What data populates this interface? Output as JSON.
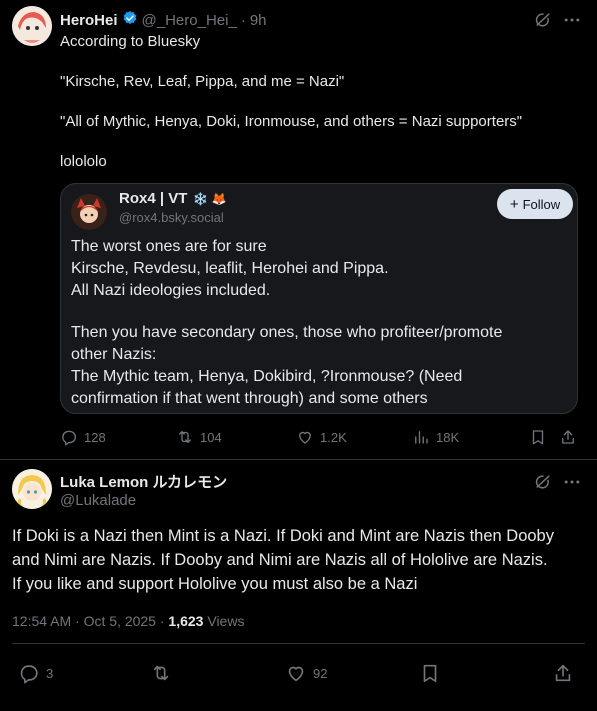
{
  "post1": {
    "author_name": "HeroHei",
    "handle": "@_Hero_Hei_",
    "separator": "·",
    "time": "9h",
    "text_lines": [
      "According to Bluesky",
      "\"Kirsche, Rev, Leaf, Pippa, and me = Nazi\"",
      "\"All of Mythic, Henya, Doki, Ironmouse, and others = Nazi supporters\"",
      "lolololo"
    ],
    "quote": {
      "author_name": "Rox4 | VT",
      "emojis": "❄️ 🦊",
      "handle": "@rox4.bsky.social",
      "follow_label": "Follow",
      "paragraph1": [
        "The worst ones are for sure",
        "Kirsche, Revdesu, leaflit, Herohei and Pippa.",
        "All Nazi ideologies included."
      ],
      "paragraph2": [
        "Then you have secondary ones, those who profiteer/promote",
        "other Nazis:",
        "The Mythic team, Henya, Dokibird, ?Ironmouse? (Need",
        "confirmation if that went through) and some others"
      ]
    },
    "actions": {
      "replies": "128",
      "reposts": "104",
      "likes": "1.2K",
      "views": "18K"
    }
  },
  "post2": {
    "author_name": "Luka Lemon ルカレモン",
    "handle": "@Lukalade",
    "text_lines": [
      "If Doki is a Nazi then Mint is a Nazi. If Doki and Mint are Nazis then Dooby",
      "and Nimi are Nazis. If Dooby and Nimi are Nazis all of Hololive are Nazis.",
      "If you like and support Hololive you must also be a Nazi"
    ],
    "timestamp": "12:54 AM · Oct 5, 2025 · ",
    "views_count": "1,623",
    "views_label": " Views",
    "actions": {
      "replies": "3",
      "likes": "92"
    }
  },
  "colors": {
    "background": "#000000",
    "text": "#e7e9ea",
    "muted": "#71767b",
    "verified": "#1d9bf0",
    "quote_bg": "#16181c",
    "border": "#2f3336"
  }
}
